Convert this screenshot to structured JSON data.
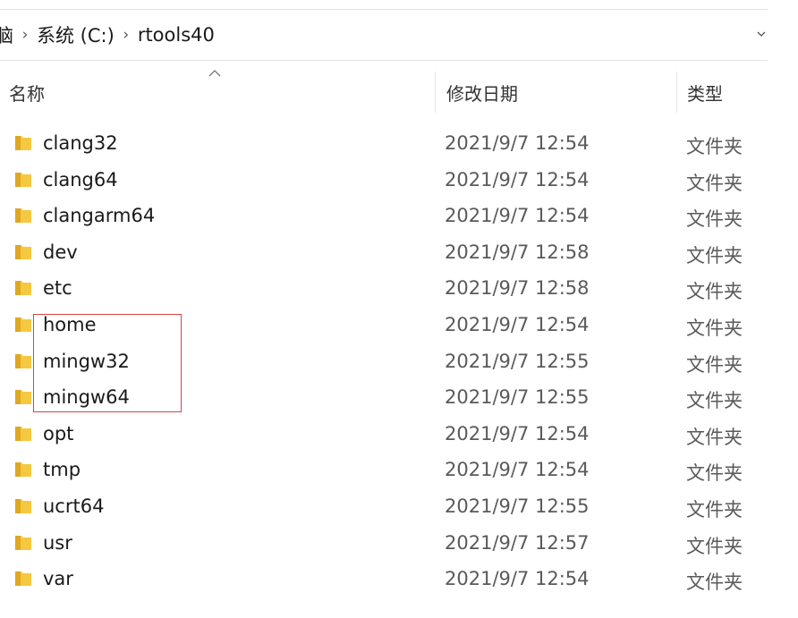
{
  "address_bar": {
    "truncated_crumb": "电脑",
    "crumbs": [
      "系统 (C:)",
      "rtools40"
    ],
    "separator": "›"
  },
  "columns": {
    "name": "名称",
    "date_modified": "修改日期",
    "type": "类型"
  },
  "sort": {
    "column": "name",
    "direction": "ascending",
    "icon": "chevron-up-icon"
  },
  "files": [
    {
      "name": "clang32",
      "date": "2021/9/7 12:54",
      "type": "文件夹"
    },
    {
      "name": "clang64",
      "date": "2021/9/7 12:54",
      "type": "文件夹"
    },
    {
      "name": "clangarm64",
      "date": "2021/9/7 12:54",
      "type": "文件夹"
    },
    {
      "name": "dev",
      "date": "2021/9/7 12:58",
      "type": "文件夹"
    },
    {
      "name": "etc",
      "date": "2021/9/7 12:58",
      "type": "文件夹"
    },
    {
      "name": "home",
      "date": "2021/9/7 12:54",
      "type": "文件夹"
    },
    {
      "name": "mingw32",
      "date": "2021/9/7 12:55",
      "type": "文件夹"
    },
    {
      "name": "mingw64",
      "date": "2021/9/7 12:55",
      "type": "文件夹"
    },
    {
      "name": "opt",
      "date": "2021/9/7 12:54",
      "type": "文件夹"
    },
    {
      "name": "tmp",
      "date": "2021/9/7 12:54",
      "type": "文件夹"
    },
    {
      "name": "ucrt64",
      "date": "2021/9/7 12:55",
      "type": "文件夹"
    },
    {
      "name": "usr",
      "date": "2021/9/7 12:57",
      "type": "文件夹"
    },
    {
      "name": "var",
      "date": "2021/9/7 12:54",
      "type": "文件夹"
    }
  ],
  "highlight": {
    "items": [
      "home",
      "mingw32",
      "mingw64"
    ],
    "color": "#d64545"
  },
  "colors": {
    "folder_yellow": "#f5c842",
    "folder_shade": "#e0a81f"
  }
}
